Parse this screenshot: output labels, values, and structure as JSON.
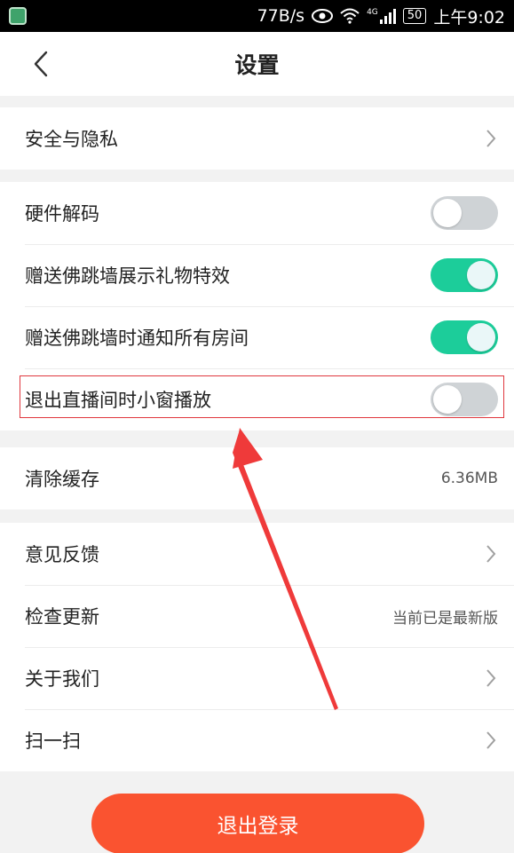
{
  "status_bar": {
    "net_speed": "77B/s",
    "network_type": "4G",
    "battery": "50",
    "time": "上午9:02"
  },
  "header": {
    "title": "设置",
    "back_icon": "chevron-left-icon"
  },
  "groups": {
    "privacy": {
      "items": [
        {
          "label": "安全与隐私",
          "action": "chevron-right-icon"
        }
      ]
    },
    "playback": {
      "items": [
        {
          "label": "硬件解码",
          "toggle": false
        },
        {
          "label": "赠送佛跳墙展示礼物特效",
          "toggle": true
        },
        {
          "label": "赠送佛跳墙时通知所有房间",
          "toggle": true
        },
        {
          "label": "退出直播间时小窗播放",
          "toggle": false
        }
      ]
    },
    "cache": {
      "items": [
        {
          "label": "清除缓存",
          "value": "6.36MB"
        }
      ]
    },
    "about": {
      "items": [
        {
          "label": "意见反馈",
          "action": "chevron-right-icon"
        },
        {
          "label": "检查更新",
          "value": "当前已是最新版"
        },
        {
          "label": "关于我们",
          "action": "chevron-right-icon"
        },
        {
          "label": "扫一扫",
          "action": "chevron-right-icon"
        }
      ]
    }
  },
  "logout_label": "退出登录",
  "colors": {
    "accent_button": "#fa5330",
    "toggle_on": "#1ccd9a",
    "toggle_off": "#cfd3d6",
    "annotation": "#e0383e"
  }
}
